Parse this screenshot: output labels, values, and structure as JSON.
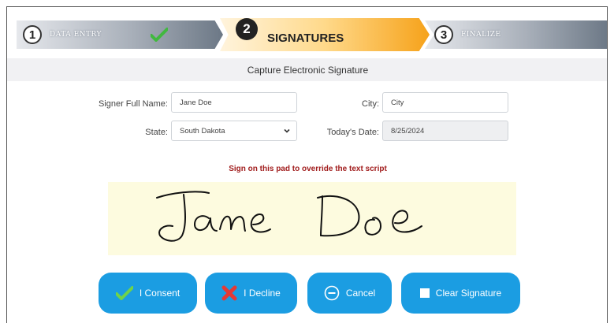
{
  "steps": [
    {
      "number": "1",
      "label": "DATA ENTRY",
      "status": "complete"
    },
    {
      "number": "2",
      "label": "SIGNATURES",
      "status": "active"
    },
    {
      "number": "3",
      "label": "FINALIZE",
      "status": "pending"
    }
  ],
  "subheader": "Capture Electronic Signature",
  "form": {
    "signer_label": "Signer Full Name:",
    "signer_value": "Jane Doe",
    "city_label": "City:",
    "city_value": "City",
    "state_label": "State:",
    "state_value": "South Dakota",
    "date_label": "Today's Date:",
    "date_value": "8/25/2024"
  },
  "sign_hint": "Sign on this pad to override the text script",
  "buttons": {
    "consent": "I Consent",
    "decline": "I Decline",
    "cancel": "Cancel",
    "clear": "Clear Signature"
  },
  "colors": {
    "button": "#1b9de2",
    "hint": "#a11d1d",
    "pad": "#fdfbdf",
    "active_step": "#f6a21a"
  }
}
